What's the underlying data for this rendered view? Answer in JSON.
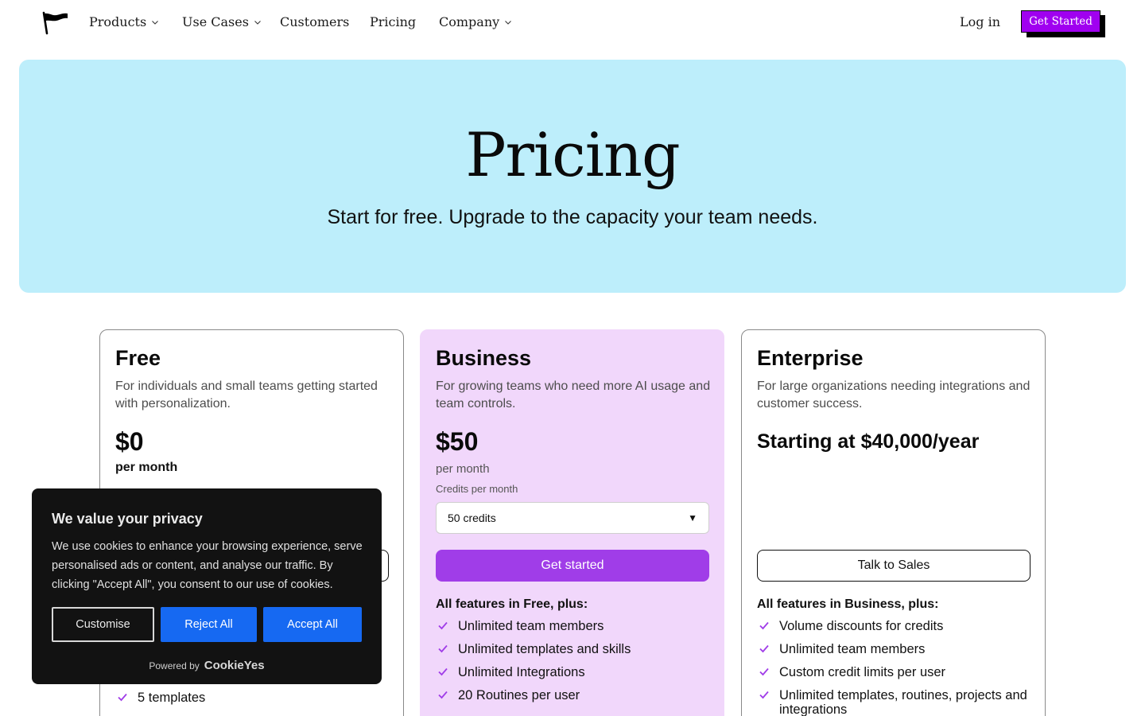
{
  "nav": {
    "items": [
      {
        "label": "Products",
        "dropdown": true
      },
      {
        "label": "Use Cases",
        "dropdown": true
      },
      {
        "label": "Customers",
        "dropdown": false
      },
      {
        "label": "Pricing",
        "dropdown": false
      },
      {
        "label": "Company",
        "dropdown": true
      }
    ],
    "login": "Log in",
    "cta": "Get Started",
    "logo_icon": "flag-icon"
  },
  "hero": {
    "title": "Pricing",
    "subtitle": "Start for free. Upgrade to the capacity your team needs."
  },
  "plans": {
    "free": {
      "name": "Free",
      "description": "For individuals and small teams getting started with personalization.",
      "price": "$0",
      "period": "per month",
      "features_visible": [
        "5 templates"
      ]
    },
    "business": {
      "name": "Business",
      "description": "For growing teams who need more AI usage and team controls.",
      "price": "$50",
      "period": "per month",
      "credits_label": "Credits per month",
      "credits_selected": "50 credits",
      "button": "Get started",
      "features_head": "All features in Free, plus:",
      "features": [
        "Unlimited team members",
        "Unlimited templates and skills",
        "Unlimited Integrations",
        "20 Routines per user"
      ]
    },
    "enterprise": {
      "name": "Enterprise",
      "description": "For large organizations needing integrations and customer success.",
      "price": "Starting at $40,000/year",
      "button": "Talk to Sales",
      "features_head": "All features in Business, plus:",
      "features": [
        "Volume discounts for credits",
        "Unlimited team members",
        "Custom credit limits per user",
        "Unlimited templates, routines, projects and integrations"
      ]
    }
  },
  "cookie": {
    "title": "We value your privacy",
    "text": "We use cookies to enhance your browsing experience, serve personalised ads or content, and analyse our traffic. By clicking \"Accept All\", you consent to our use of cookies.",
    "customise": "Customise",
    "reject": "Reject All",
    "accept": "Accept All",
    "powered_by": "Powered by",
    "brand": "CookieYes"
  },
  "colors": {
    "hero_bg": "#bdeefb",
    "business_bg": "#f1d7fb",
    "accent_purple": "#a03de8",
    "cta_purple": "#a000f0",
    "cookie_blue": "#1669f2"
  }
}
